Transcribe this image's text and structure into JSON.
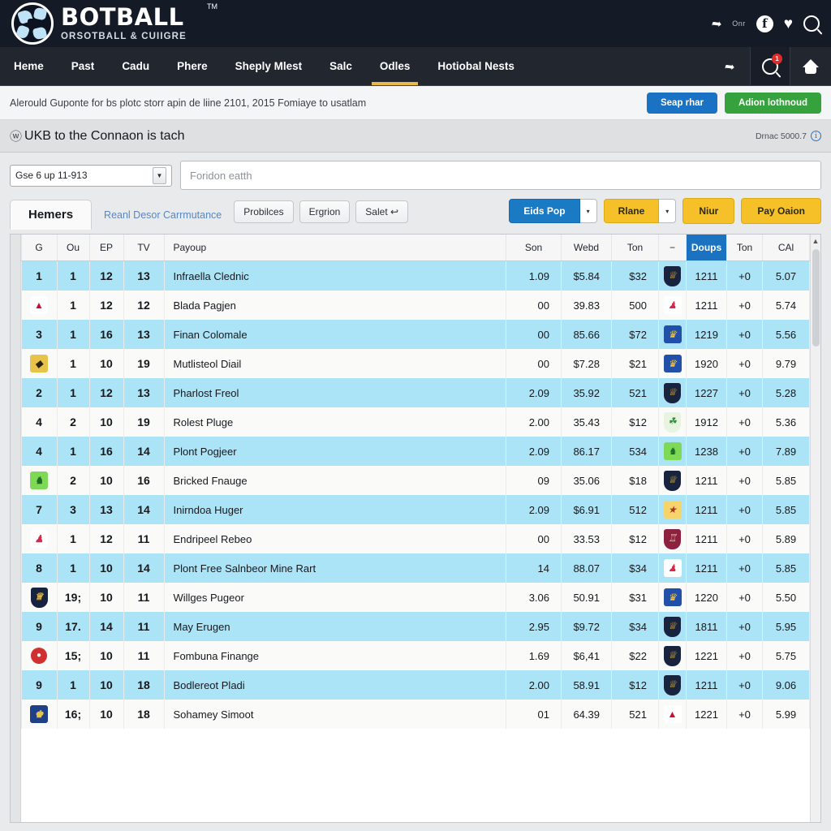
{
  "brand": {
    "name": "BOTBALL",
    "tm": "TM",
    "tagline": "ORSOTBALL & CUIIGRE",
    "tagline_dot": "♣",
    "header_note": "Onr",
    "icons": {
      "share": "share-icon",
      "facebook": "f",
      "heart": "♥",
      "search": "search-icon"
    }
  },
  "nav": {
    "items": [
      {
        "label": "Heme",
        "active": false
      },
      {
        "label": "Past",
        "active": false
      },
      {
        "label": "Cadu",
        "active": false
      },
      {
        "label": "Phere",
        "active": false
      },
      {
        "label": "Sheply Mlest",
        "active": false
      },
      {
        "label": "Salc",
        "active": false
      },
      {
        "label": "Odles",
        "active": true
      },
      {
        "label": "Hotiobal Nests",
        "active": false
      }
    ],
    "search_badge": "1"
  },
  "notice": {
    "text": "Alerould Guponte for bs plotc storr apin de liine 2101, 2015 Fomiaye to usatlam",
    "primary_button": "Seap rhar",
    "secondary_button": "Adion lothnoud"
  },
  "pagehead": {
    "glyph": "ⓦ",
    "title": "UKB to the Connaon is tach",
    "meta": "Drnac 5000.7",
    "info_icon": "i"
  },
  "filters": {
    "select_value": "Gse 6 up 11-913",
    "search_placeholder": "Foridon eatth"
  },
  "tabs": {
    "active": "Hemers",
    "link": "Reanl Desor Carrmutance",
    "buttons": [
      "Probilces",
      "Ergrion",
      "Salet ↩"
    ]
  },
  "actions": {
    "primary_split": "Eids Pop",
    "secondary_split": "Rlane",
    "button_3": "Niur",
    "button_4": "Pay Oaion",
    "caret": "▾"
  },
  "colors": {
    "brand_dark": "#151a27",
    "nav_dark": "#21262f",
    "accent_yellow": "#e8b84b",
    "primary_blue": "#1b72c4",
    "green": "#35a23d",
    "row_highlight": "#ace4f7",
    "sort_header": "#1b72c0"
  },
  "table": {
    "columns": [
      "G",
      "Ou",
      "EP",
      "TV",
      "Payoup",
      "Son",
      "Webd",
      "Ton",
      "−",
      "Doups",
      "Ton",
      "CAl"
    ],
    "sorted_column": "Doups",
    "rows": [
      {
        "g": "1",
        "g_logo": null,
        "ou": "1",
        "ep": "12",
        "tv": "13",
        "name": "Infraella Clednic",
        "son": "1.09",
        "webd": "$5.84",
        "ton": "$32",
        "crest": {
          "shape": "crest",
          "bg": "#17233f",
          "fg": "#e3b83c",
          "glyph": "♕"
        },
        "doups": "1211",
        "ton2": "+0",
        "cal": "5.07"
      },
      {
        "g": "",
        "g_logo": {
          "shape": "tri",
          "bg": "#ffffff",
          "fg": "#c8102e",
          "glyph": "▲"
        },
        "ou": "1",
        "ep": "12",
        "tv": "12",
        "name": "Blada Pagjen",
        "son": "00",
        "webd": "39.83",
        "ton": "500",
        "crest": {
          "shape": "sq",
          "bg": "#ffffff",
          "fg": "#d6294a",
          "glyph": "♟"
        },
        "doups": "1211",
        "ton2": "+0",
        "cal": "5.74"
      },
      {
        "g": "3",
        "g_logo": null,
        "ou": "1",
        "ep": "16",
        "tv": "13",
        "name": "Finan Colomale",
        "son": "00",
        "webd": "85.66",
        "ton": "$72",
        "crest": {
          "shape": "sq",
          "bg": "#2150a8",
          "fg": "#f2c94c",
          "glyph": "♛"
        },
        "doups": "1219",
        "ton2": "+0",
        "cal": "5.56"
      },
      {
        "g": "",
        "g_logo": {
          "shape": "sq",
          "bg": "#e8c34a",
          "fg": "#2c2410",
          "glyph": "◆"
        },
        "ou": "1",
        "ep": "10",
        "tv": "19",
        "name": "Mutlisteol Diail",
        "son": "00",
        "webd": "$7.28",
        "ton": "$21",
        "crest": {
          "shape": "sq",
          "bg": "#2150a8",
          "fg": "#f2c94c",
          "glyph": "♛"
        },
        "doups": "1920",
        "ton2": "+0",
        "cal": "9.79"
      },
      {
        "g": "2",
        "g_logo": null,
        "ou": "1",
        "ep": "12",
        "tv": "13",
        "name": "Pharlost Freol",
        "son": "2.09",
        "webd": "35.92",
        "ton": "521",
        "crest": {
          "shape": "crest",
          "bg": "#17233f",
          "fg": "#e3b83c",
          "glyph": "♕"
        },
        "doups": "1227",
        "ton2": "+0",
        "cal": "5.28"
      },
      {
        "g": "4",
        "g_logo": null,
        "ou": "2",
        "ep": "10",
        "tv": "19",
        "name": "Rolest Pluge",
        "son": "2.00",
        "webd": "35.43",
        "ton": "$12",
        "crest": {
          "shape": "crest",
          "bg": "#e8f3e0",
          "fg": "#2f8f3e",
          "glyph": "☘"
        },
        "doups": "1912",
        "ton2": "+0",
        "cal": "5.36"
      },
      {
        "g": "4",
        "g_logo": null,
        "ou": "1",
        "ep": "16",
        "tv": "14",
        "name": "Plont Pogjeer",
        "son": "2.09",
        "webd": "86.17",
        "ton": "534",
        "crest": {
          "shape": "sq",
          "bg": "#7ed957",
          "fg": "#1e6b22",
          "glyph": "♞"
        },
        "doups": "1238",
        "ton2": "+0",
        "cal": "7.89"
      },
      {
        "g": "",
        "g_logo": {
          "shape": "sq",
          "bg": "#7ed957",
          "fg": "#1e6b22",
          "glyph": "♞"
        },
        "ou": "2",
        "ep": "10",
        "tv": "16",
        "name": "Bricked Fnauge",
        "son": "09",
        "webd": "35.06",
        "ton": "$18",
        "crest": {
          "shape": "crest",
          "bg": "#17233f",
          "fg": "#e3b83c",
          "glyph": "♕"
        },
        "doups": "1211",
        "ton2": "+0",
        "cal": "5.85"
      },
      {
        "g": "7",
        "g_logo": null,
        "ou": "3",
        "ep": "13",
        "tv": "14",
        "name": "Inirndoa Huger",
        "son": "2.09",
        "webd": "$6.91",
        "ton": "512",
        "crest": {
          "shape": "sq",
          "bg": "#f6d36b",
          "fg": "#a8341e",
          "glyph": "★"
        },
        "doups": "1211",
        "ton2": "+0",
        "cal": "5.85"
      },
      {
        "g": "",
        "g_logo": {
          "shape": "sq",
          "bg": "#ffffff",
          "fg": "#d6294a",
          "glyph": "♟"
        },
        "ou": "1",
        "ep": "12",
        "tv": "11",
        "name": "Endripeel Rebeo",
        "son": "00",
        "webd": "33.53",
        "ton": "$12",
        "crest": {
          "shape": "crest",
          "bg": "#8e2140",
          "fg": "#f0d9b5",
          "glyph": "♖"
        },
        "doups": "1211",
        "ton2": "+0",
        "cal": "5.89"
      },
      {
        "g": "8",
        "g_logo": null,
        "ou": "1",
        "ep": "10",
        "tv": "14",
        "name": "Plont Free Salnbeor Mine Rart",
        "son": "14",
        "webd": "88.07",
        "ton": "$34",
        "crest": {
          "shape": "sq",
          "bg": "#ffffff",
          "fg": "#d6294a",
          "glyph": "♟"
        },
        "doups": "1211",
        "ton2": "+0",
        "cal": "5.85"
      },
      {
        "g": "",
        "g_logo": {
          "shape": "crest",
          "bg": "#17233f",
          "fg": "#e3b83c",
          "glyph": "♕"
        },
        "ou": "19;",
        "ep": "10",
        "tv": "11",
        "name": "Willges Pugeor",
        "son": "3.06",
        "webd": "50.91",
        "ton": "$31",
        "crest": {
          "shape": "sq",
          "bg": "#2150a8",
          "fg": "#f2c94c",
          "glyph": "♛"
        },
        "doups": "1220",
        "ton2": "+0",
        "cal": "5.50"
      },
      {
        "g": "9",
        "g_logo": null,
        "ou": "17.",
        "ep": "14",
        "tv": "11",
        "name": "May Erugen",
        "son": "2.95",
        "webd": "$9.72",
        "ton": "$34",
        "crest": {
          "shape": "crest",
          "bg": "#17233f",
          "fg": "#e3b83c",
          "glyph": "♕"
        },
        "doups": "1811",
        "ton2": "+0",
        "cal": "5.95"
      },
      {
        "g": "",
        "g_logo": {
          "shape": "circ",
          "bg": "#d13030",
          "fg": "#ffffff",
          "glyph": "●"
        },
        "ou": "15;",
        "ep": "10",
        "tv": "11",
        "name": "Fombuna Finange",
        "son": "1.69",
        "webd": "$6,41",
        "ton": "$22",
        "crest": {
          "shape": "crest",
          "bg": "#17233f",
          "fg": "#e3b83c",
          "glyph": "♕"
        },
        "doups": "1221",
        "ton2": "+0",
        "cal": "5.75"
      },
      {
        "g": "9",
        "g_logo": null,
        "ou": "1",
        "ep": "10",
        "tv": "18",
        "name": "Bodlereot Pladi",
        "son": "2.00",
        "webd": "58.91",
        "ton": "$12",
        "crest": {
          "shape": "crest",
          "bg": "#17233f",
          "fg": "#e3b83c",
          "glyph": "♕"
        },
        "doups": "1211",
        "ton2": "+0",
        "cal": "9.06"
      },
      {
        "g": "",
        "g_logo": {
          "shape": "sq",
          "bg": "#1f3f86",
          "fg": "#e8c34a",
          "glyph": "♚"
        },
        "ou": "16;",
        "ep": "10",
        "tv": "18",
        "name": "Sohamey Simoot",
        "son": "01",
        "webd": "64.39",
        "ton": "521",
        "crest": {
          "shape": "tri",
          "bg": "#ffffff",
          "fg": "#c8102e",
          "glyph": "▲"
        },
        "doups": "1221",
        "ton2": "+0",
        "cal": "5.99"
      }
    ]
  },
  "scrollbar": {
    "up_arrow": "⬆"
  }
}
